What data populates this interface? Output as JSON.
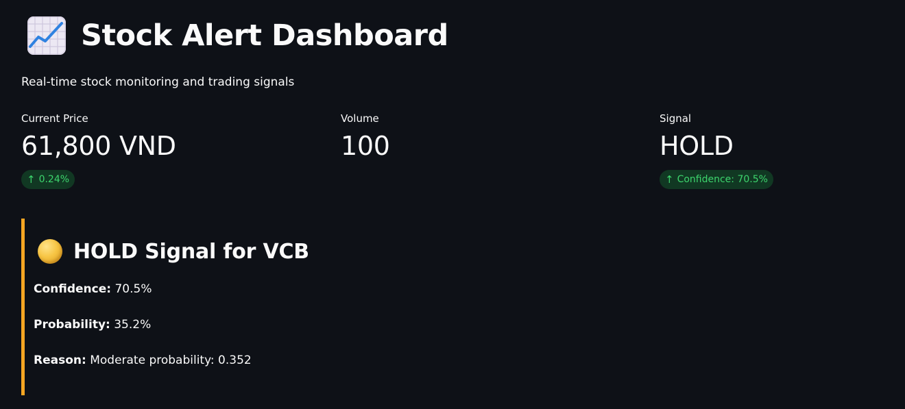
{
  "header": {
    "title": "Stock Alert Dashboard",
    "icon": "chart-increasing-icon",
    "subtitle": "Real-time stock monitoring and trading signals"
  },
  "metrics": [
    {
      "label": "Current Price",
      "value": "61,800 VND",
      "delta": "0.24%",
      "delta_direction": "up"
    },
    {
      "label": "Volume",
      "value": "100"
    },
    {
      "label": "Signal",
      "value": "HOLD",
      "delta": "Confidence: 70.5%",
      "delta_direction": "up"
    }
  ],
  "alert": {
    "icon": "yellow-circle-icon",
    "title": "HOLD Signal for VCB",
    "accent_color": "#f5a623",
    "lines": [
      {
        "label": "Confidence:",
        "value": "70.5%"
      },
      {
        "label": "Probability:",
        "value": "35.2%"
      },
      {
        "label": "Reason:",
        "value": "Moderate probability: 0.352"
      }
    ]
  },
  "colors": {
    "background": "#0e1117",
    "text": "#fafafa",
    "positive": "#3dd56d"
  }
}
